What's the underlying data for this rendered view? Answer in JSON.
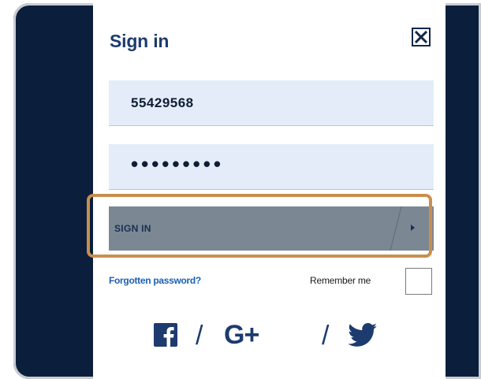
{
  "dialog": {
    "title": "Sign in",
    "close_icon": "close-icon"
  },
  "form": {
    "username_value": "55429568",
    "password_value": "•••••••••",
    "signin_label": "SIGN IN",
    "forgot_label": "Forgotten password?",
    "remember_label": "Remember me",
    "remember_checked": false
  },
  "social": {
    "separator": "/",
    "gplus_label": "G+",
    "icons": [
      "facebook-icon",
      "google-plus-icon",
      "twitter-icon"
    ]
  },
  "colors": {
    "background": "#0b1f3d",
    "accent": "#1d3b6e",
    "field_bg": "#e3ecf8",
    "button_bg": "#7b8894",
    "highlight": "#c88f4e",
    "link": "#1d5fb4"
  }
}
